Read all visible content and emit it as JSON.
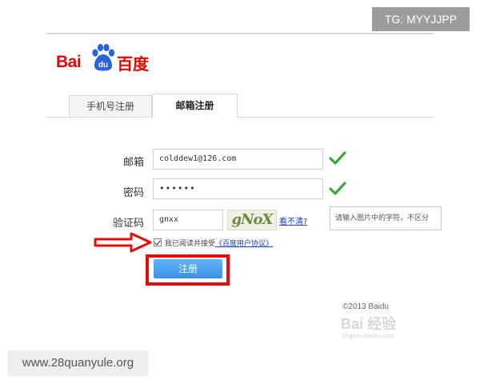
{
  "overlay_badge": "TG: MYYJJPP",
  "logo": {
    "latin": "Bai",
    "paw_text": "du",
    "chinese": "百度"
  },
  "tabs": [
    {
      "label": "手机号注册",
      "active": false
    },
    {
      "label": "邮箱注册",
      "active": true
    }
  ],
  "form": {
    "email": {
      "label": "邮箱",
      "value": "colddew1@126.com",
      "valid": true
    },
    "password": {
      "label": "密码",
      "value": "••••••",
      "valid": true
    },
    "captcha": {
      "label": "验证码",
      "value": "gnxx",
      "image_text": "gNoX",
      "refresh_link": "看不清?",
      "hint": "请输入图片中的字符，不区分"
    },
    "agree": {
      "checked": true,
      "text": "我已阅读并接受",
      "link": "《百度用户协议》"
    },
    "submit_label": "注册"
  },
  "footer": {
    "copyright": "©2013 Baidu",
    "watermark": "Bai 经验",
    "watermark_url": "jingyan.baidu.com"
  },
  "site_badge": "www.28quanyule.org",
  "colors": {
    "brand_red": "#e10602",
    "check_green": "#3fa73f",
    "link_blue": "#1e43b8",
    "button_blue": "#3a92e4",
    "highlight_red": "#e60c0c"
  },
  "icons": [
    "baidu-paw-icon",
    "check-icon",
    "red-arrow-icon",
    "checkbox-icon"
  ]
}
